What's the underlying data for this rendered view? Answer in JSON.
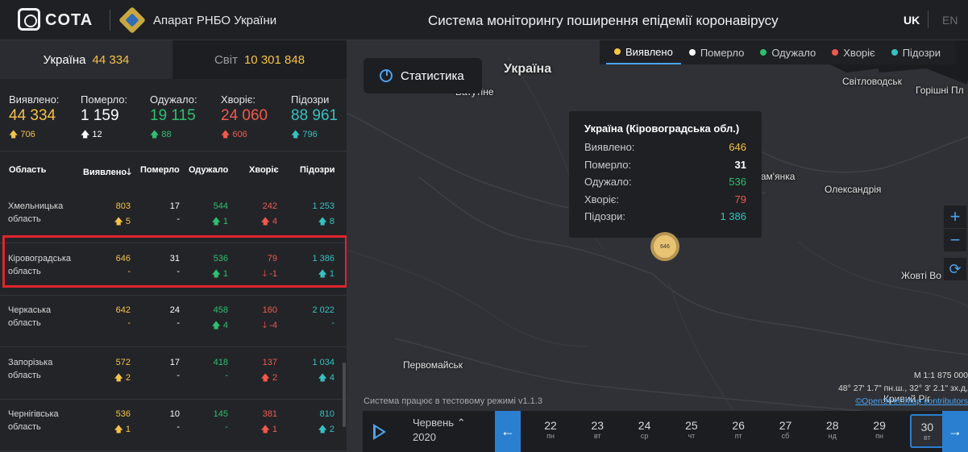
{
  "header": {
    "brand": "COTA",
    "org": "Апарат РНБО України",
    "title": "Система моніторингу поширення епідемії коронавірусу",
    "lang_uk": "UK",
    "lang_en": "EN"
  },
  "scope": {
    "ukraine_label": "Україна",
    "ukraine_value": "44 334",
    "world_label": "Світ",
    "world_value": "10 301 848"
  },
  "summary": [
    {
      "label": "Виявлено:",
      "value": "44 334",
      "delta": "706"
    },
    {
      "label": "Померло:",
      "value": "1 159",
      "delta": "12"
    },
    {
      "label": "Одужало:",
      "value": "19 115",
      "delta": "88"
    },
    {
      "label": "Хворіє:",
      "value": "24 060",
      "delta": "606"
    },
    {
      "label": "Підозри",
      "value": "88 961",
      "delta": "796"
    }
  ],
  "table": {
    "headers": [
      "Область",
      "Виявлено",
      "Померло",
      "Одужало",
      "Хворіє",
      "Підозри"
    ],
    "sort_icon": "arrow-down-icon",
    "rows": [
      {
        "name": "Хмельницька область",
        "v": "803",
        "vd": "5",
        "p": "17",
        "pd": "-",
        "o": "544",
        "od": "1",
        "h": "242",
        "hd": "4",
        "s": "1 253",
        "sd": "8"
      },
      {
        "name": "Кіровоградська область",
        "v": "646",
        "vd": "-",
        "p": "31",
        "pd": "-",
        "o": "536",
        "od": "1",
        "h": "79",
        "hd": "-1",
        "s": "1 386",
        "sd": "1"
      },
      {
        "name": "Черкаська область",
        "v": "642",
        "vd": "-",
        "p": "24",
        "pd": "-",
        "o": "458",
        "od": "4",
        "h": "160",
        "hd": "-4",
        "s": "2 022",
        "sd": "-"
      },
      {
        "name": "Запорізька область",
        "v": "572",
        "vd": "2",
        "p": "17",
        "pd": "-",
        "o": "418",
        "od": "-",
        "h": "137",
        "hd": "2",
        "s": "1 034",
        "sd": "4"
      },
      {
        "name": "Чернігівська область",
        "v": "536",
        "vd": "1",
        "p": "10",
        "pd": "-",
        "o": "145",
        "od": "-",
        "h": "381",
        "hd": "1",
        "s": "810",
        "sd": "2"
      }
    ]
  },
  "map": {
    "stats_button": "Статистика",
    "legend": [
      {
        "label": "Виявлено",
        "color": "#f5c247"
      },
      {
        "label": "Померло",
        "color": "#ffffff"
      },
      {
        "label": "Одужало",
        "color": "#2fbf71"
      },
      {
        "label": "Хворіє",
        "color": "#ef5a4e"
      },
      {
        "label": "Підозри",
        "color": "#37c1c0"
      }
    ],
    "labels": {
      "ukraine": "Україна",
      "vatutine": "Ватутіне",
      "svitlovodsk": "Світловодськ",
      "horishni": "Горішні Пл",
      "znamianka": "Знам'янка",
      "oleksandriia": "Олександрія",
      "zhovti": "Жовті Во",
      "pervomaisk": "Первомайськ",
      "kryvyi": "Кривий Ріг"
    },
    "tooltip": {
      "title": "Україна (Кіровоградська обл.)",
      "rows": [
        {
          "label": "Виявлено:",
          "value": "646"
        },
        {
          "label": "Померло:",
          "value": "31"
        },
        {
          "label": "Одужало:",
          "value": "536"
        },
        {
          "label": "Хворіє:",
          "value": "79"
        },
        {
          "label": "Підозри:",
          "value": "1 386"
        }
      ]
    },
    "marker_value": "646",
    "scale": "M 1:1 875 000",
    "coords": "48° 27' 1.7\" пн.ш., 32° 3' 2.1\" зх.д,",
    "osm": "©OpenStreetMap contributors",
    "status": "Система працює в тестовому режимі v1.1.3"
  },
  "timeline": {
    "month": "Червень",
    "year": "2020",
    "days": [
      {
        "n": "22",
        "w": "пн"
      },
      {
        "n": "23",
        "w": "вт"
      },
      {
        "n": "24",
        "w": "ср"
      },
      {
        "n": "25",
        "w": "чт"
      },
      {
        "n": "26",
        "w": "пт"
      },
      {
        "n": "27",
        "w": "сб"
      },
      {
        "n": "28",
        "w": "нд"
      },
      {
        "n": "29",
        "w": "пн"
      },
      {
        "n": "30",
        "w": "вт"
      }
    ],
    "selected_day": "30"
  }
}
